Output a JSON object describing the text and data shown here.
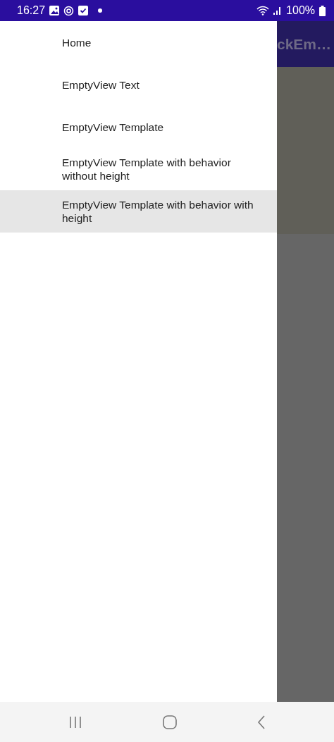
{
  "status_bar": {
    "time": "16:27",
    "battery": "100%"
  },
  "app_bar": {
    "title": "ckEm…"
  },
  "drawer": {
    "items": [
      {
        "label": "Home",
        "selected": false
      },
      {
        "label": "EmptyView Text",
        "selected": false
      },
      {
        "label": "EmptyView Template",
        "selected": false
      },
      {
        "label": "EmptyView Template with behavior without height",
        "selected": false
      },
      {
        "label": "EmptyView Template with behavior with height",
        "selected": true
      }
    ]
  }
}
